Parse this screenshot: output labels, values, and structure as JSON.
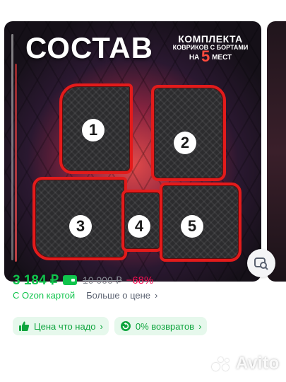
{
  "banner": {
    "title": "СОСТАВ",
    "subtitle_line1": "КОМПЛЕКТА",
    "subtitle_line2": "КОВРИКОВ С БОРТАМИ",
    "subtitle_prefix": "НА",
    "subtitle_count": "5",
    "subtitle_suffix": "МЕСТ",
    "mats": [
      "1",
      "2",
      "3",
      "4",
      "5"
    ]
  },
  "price": {
    "current": "3 184 ₽",
    "old": "10 000 ₽",
    "discount": "−68%",
    "ozon_card": "С Ozon картой",
    "more": "Больше о цене",
    "more_chevron": "›"
  },
  "chips": [
    {
      "label": "Цена что надо",
      "icon": "thumbs-up-icon",
      "chevron": "›"
    },
    {
      "label": "0% возвратов",
      "icon": "return-icon",
      "chevron": "›"
    }
  ],
  "watermark": "Avito",
  "colors": {
    "accent_green": "#10c44c",
    "discount_pink": "#f91155",
    "mat_border": "#e31b1b"
  }
}
